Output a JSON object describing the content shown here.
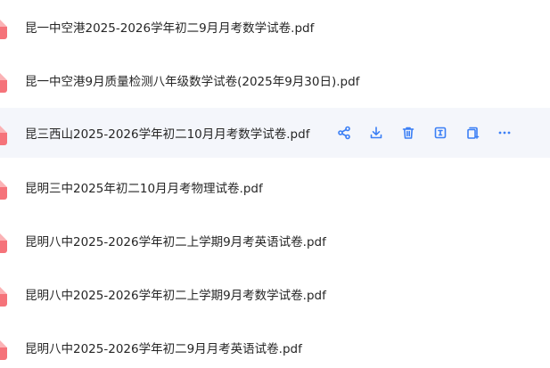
{
  "files": [
    {
      "name": "昆一中空港2025-2026学年初二9月月考数学试卷.pdf",
      "icon": "pdf-file-icon"
    },
    {
      "name": "昆一中空港9月质量检测八年级数学试卷(2025年9月30日).pdf",
      "icon": "pdf-file-icon"
    },
    {
      "name": "昆三西山2025-2026学年初二10月月考数学试卷.pdf",
      "icon": "pdf-file-icon"
    },
    {
      "name": "昆明三中2025年初二10月月考物理试卷.pdf",
      "icon": "pdf-file-icon"
    },
    {
      "name": "昆明八中2025-2026学年初二上学期9月考英语试卷.pdf",
      "icon": "pdf-file-icon"
    },
    {
      "name": "昆明八中2025-2026学年初二上学期9月考数学试卷.pdf",
      "icon": "pdf-file-icon"
    },
    {
      "name": "昆明八中2025-2026学年初二9月月考英语试卷.pdf",
      "icon": "pdf-file-icon"
    }
  ],
  "hovered_row_actions": [
    "share-icon",
    "download-icon",
    "delete-icon",
    "rename-icon",
    "copy-icon",
    "more-icon"
  ],
  "colors": {
    "pdf_icon": "#f5737a",
    "action_icon": "#3b7ff5",
    "hover_row": "#f4f6fb",
    "text": "#262626"
  }
}
